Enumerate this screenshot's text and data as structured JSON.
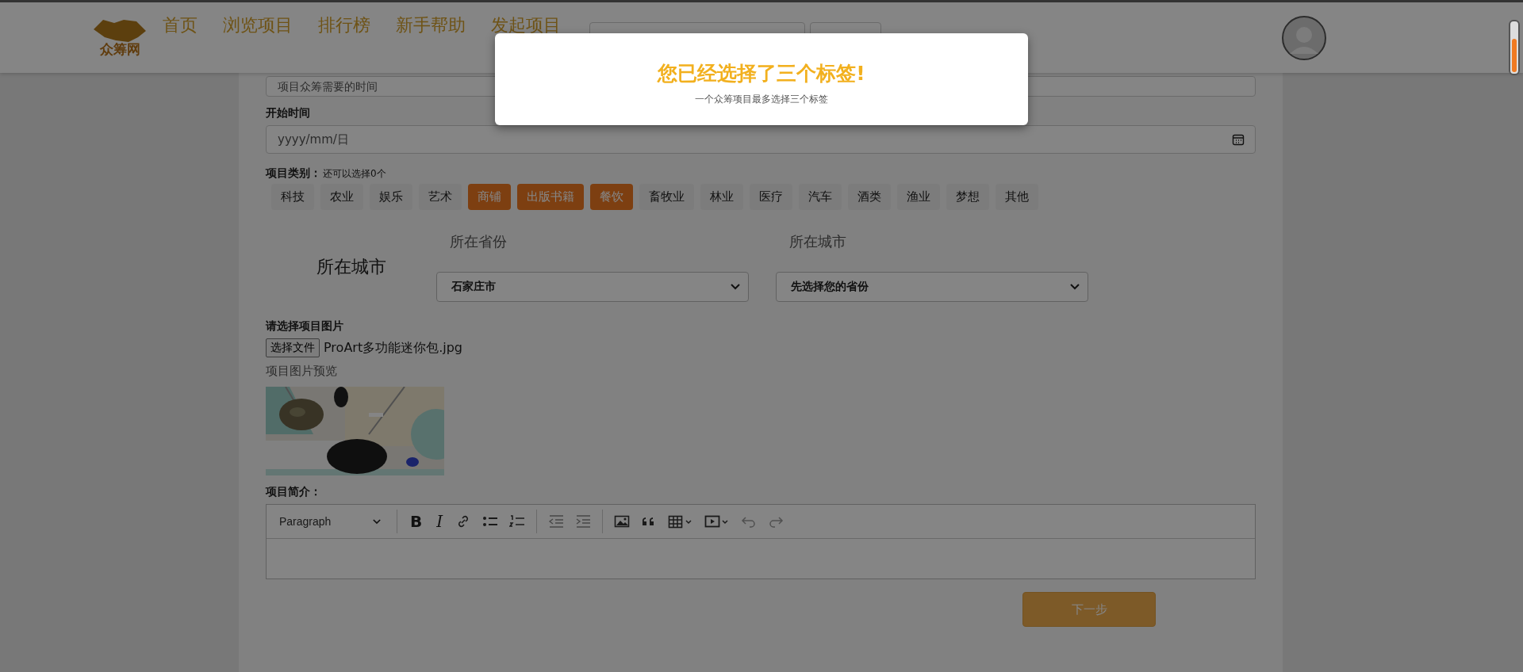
{
  "header": {
    "logo_text": "众筹网",
    "nav": [
      {
        "label": "首页"
      },
      {
        "label": "浏览项目"
      },
      {
        "label": "排行榜"
      },
      {
        "label": "新手帮助"
      },
      {
        "label": "发起项目"
      }
    ]
  },
  "form": {
    "duration_placeholder": "项目众筹需要的时间",
    "start_time": {
      "label": "开始时间",
      "placeholder": "yyyy/mm/日"
    },
    "category": {
      "label": "项目类别：",
      "hint": "还可以选择0个",
      "tags": [
        {
          "label": "科技",
          "selected": false
        },
        {
          "label": "农业",
          "selected": false
        },
        {
          "label": "娱乐",
          "selected": false
        },
        {
          "label": "艺术",
          "selected": false
        },
        {
          "label": "商铺",
          "selected": true
        },
        {
          "label": "出版书籍",
          "selected": true
        },
        {
          "label": "餐饮",
          "selected": true
        },
        {
          "label": "畜牧业",
          "selected": false
        },
        {
          "label": "林业",
          "selected": false
        },
        {
          "label": "医疗",
          "selected": false
        },
        {
          "label": "汽车",
          "selected": false
        },
        {
          "label": "酒类",
          "selected": false
        },
        {
          "label": "渔业",
          "selected": false
        },
        {
          "label": "梦想",
          "selected": false
        },
        {
          "label": "其他",
          "selected": false
        }
      ]
    },
    "location": {
      "title": "所在城市",
      "province_label": "所在省份",
      "province_value": "石家庄市",
      "city_label": "所在城市",
      "city_value": "先选择您的省份"
    },
    "image": {
      "label": "请选择项目图片",
      "button": "选择文件",
      "filename": "ProArt多功能迷你包.jpg",
      "preview_label": "项目图片预览"
    },
    "description": {
      "label": "项目简介：",
      "block_format": "Paragraph",
      "bold": "B",
      "italic": "I"
    },
    "next_button": "下一步"
  },
  "modal": {
    "title": "您已经选择了三个标签!",
    "message": "一个众筹项目最多选择三个标签"
  }
}
